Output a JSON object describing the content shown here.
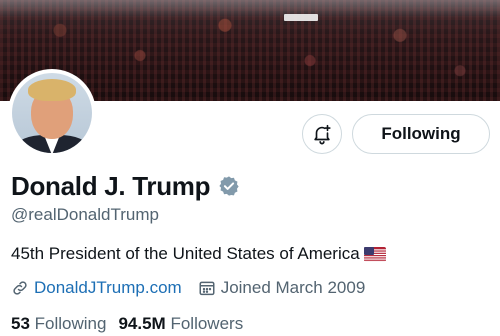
{
  "profile": {
    "display_name": "Donald J. Trump",
    "handle": "@realDonaldTrump",
    "bio": "45th President of the United States of America",
    "bio_emoji": "us-flag-emoji",
    "website": "DonaldJTrump.com",
    "joined": "Joined March 2009",
    "verified_badge": "verified-badge-icon",
    "verified_color": "#829aab"
  },
  "actions": {
    "notify_icon": "bell-plus-icon",
    "following_label": "Following"
  },
  "stats": {
    "following_count": "53",
    "following_label": "Following",
    "followers_count": "94.5M",
    "followers_label": "Followers"
  },
  "colors": {
    "link": "#1d6fb5",
    "secondary_text": "#536471",
    "border": "#cfd9de"
  }
}
